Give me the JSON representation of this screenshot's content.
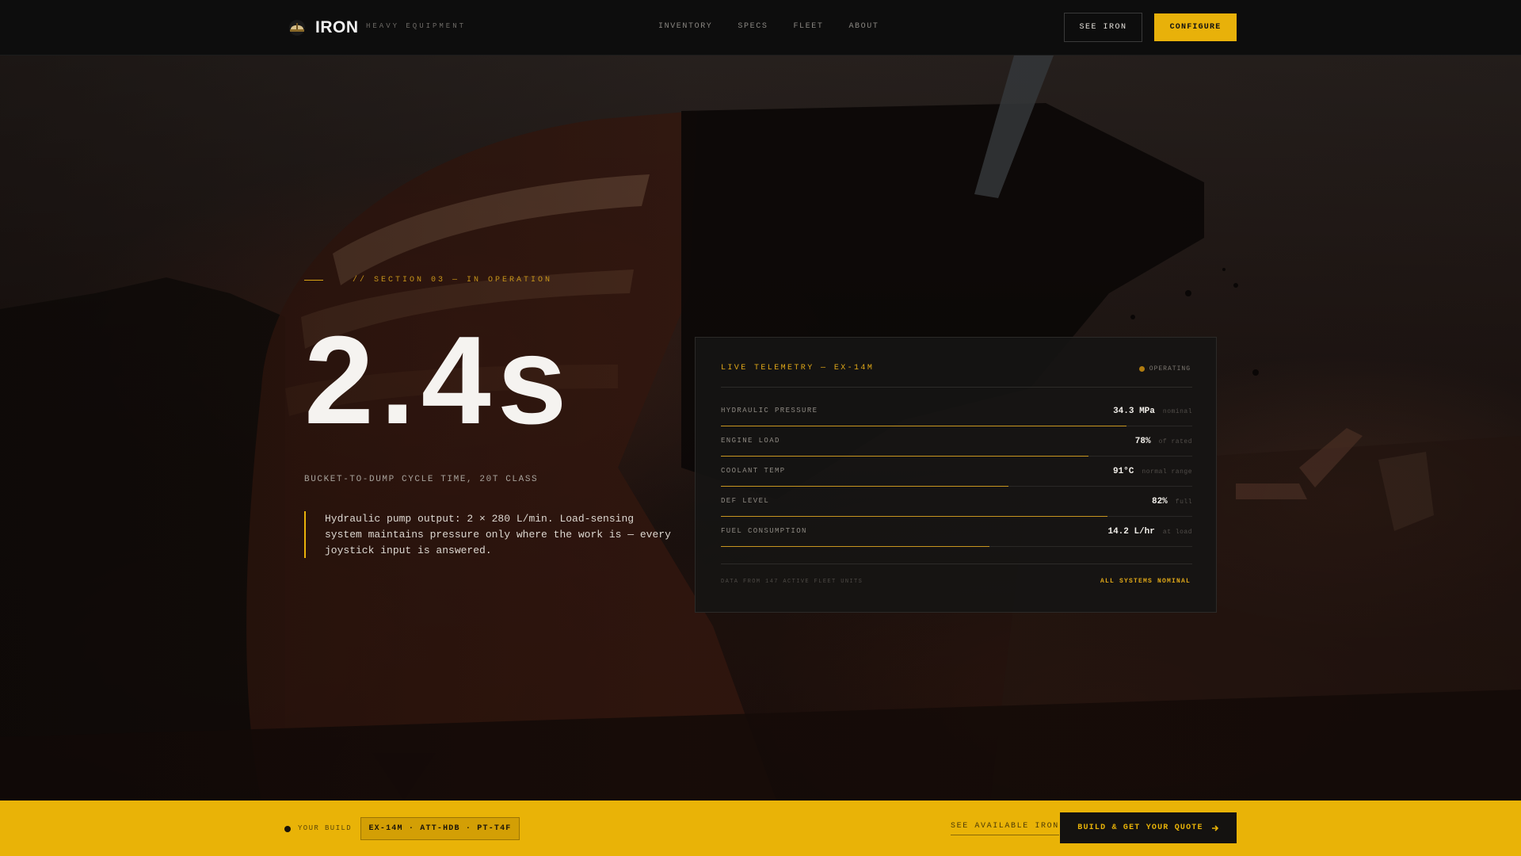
{
  "colors": {
    "accent": "#e8b10a",
    "nav_bg": "#0d0d0d",
    "card_bg": "#161413",
    "bar_fill": "#c79520"
  },
  "nav": {
    "brand": "IRON",
    "tagline": "HEAVY EQUIPMENT",
    "links": [
      "INVENTORY",
      "SPECS",
      "FLEET",
      "ABOUT"
    ],
    "see_button": "SEE IRON",
    "configure_button": "CONFIGURE"
  },
  "hero": {
    "section_label": "// SECTION 03 — IN OPERATION",
    "stat": "2.4s",
    "stat_caption": "BUCKET-TO-DUMP CYCLE TIME, 20T CLASS",
    "quote": "Hydraulic pump output: 2 × 280 L/min. Load-sensing system maintains pressure only where the work is — every joystick input is answered."
  },
  "telemetry": {
    "title": "LIVE TELEMETRY — EX-14M",
    "status": "OPERATING",
    "metrics": [
      {
        "label": "HYDRAULIC PRESSURE",
        "value": "34.3 MPa",
        "note": "nominal",
        "level": 0.86
      },
      {
        "label": "ENGINE LOAD",
        "value": "78%",
        "note": "of rated",
        "level": 0.78
      },
      {
        "label": "COOLANT TEMP",
        "value": "91°C",
        "note": "normal range",
        "level": 0.61
      },
      {
        "label": "DEF LEVEL",
        "value": "82%",
        "note": "full",
        "level": 0.82
      },
      {
        "label": "FUEL CONSUMPTION",
        "value": "14.2 L/hr",
        "note": "at load",
        "level": 0.57
      }
    ],
    "footer_left": "DATA FROM 147 ACTIVE FLEET UNITS",
    "footer_right": "ALL SYSTEMS NOMINAL"
  },
  "build_bar": {
    "label": "YOUR BUILD",
    "config": "EX-14M · ATT-HDB · PT-T4F",
    "see_link": "SEE AVAILABLE IRON",
    "quote_button": "BUILD & GET YOUR QUOTE",
    "quote_icon": "arrow-right-icon"
  }
}
